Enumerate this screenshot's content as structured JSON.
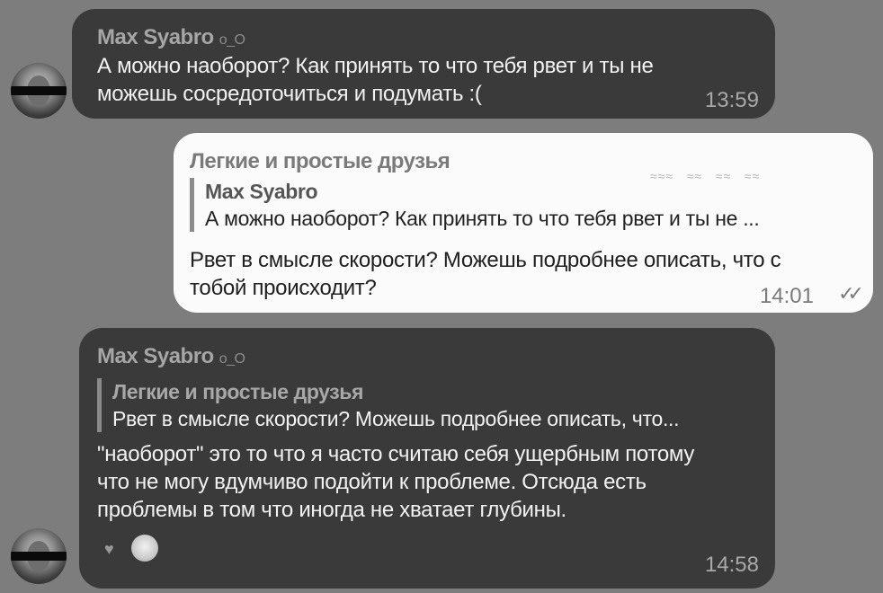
{
  "colors": {
    "background": "#7d7d7d",
    "incoming_bubble": "#3a3a3a",
    "outgoing_bubble": "#fbfbfb"
  },
  "messages": [
    {
      "sender": "Max Syabro",
      "sender_status": "o_O",
      "text": "А можно наоборот? Как принять то что тебя рвет и ты не\nможешь сосредоточиться и подумать :(",
      "time": "13:59"
    },
    {
      "reply_author": "Легкие и простые друзья",
      "quoted_sender": "Max Syabro",
      "quoted_text": "А можно наоборот? Как принять то что тебя рвет и ты не ...",
      "text": "Рвет в смысле скорости? Можешь подробнее описать, что с\nтобой происходит?",
      "time": "14:01",
      "status_icon": "double-check-icon"
    },
    {
      "sender": "Max Syabro",
      "sender_status": "o_O",
      "quoted_sender": "Легкие и простые друзья",
      "quoted_text": "Рвет в смысле скорости? Можешь подробнее описать, что...",
      "text": "\"наоборот\"  это  то что я часто считаю себя ущербным потому\nчто не могу вдумчиво подойти к проблеме. Отсюда есть\nпроблемы в том что иногда не хватает глубины.",
      "time": "14:58",
      "reaction_icon": "heart-icon"
    }
  ]
}
